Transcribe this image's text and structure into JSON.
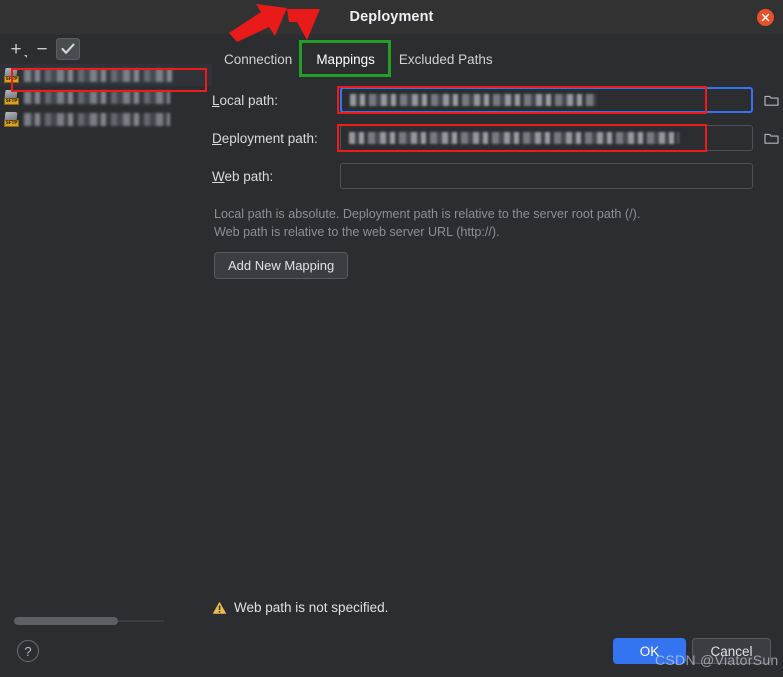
{
  "window": {
    "title": "Deployment",
    "close_icon": "close-icon"
  },
  "toolbar": {
    "add_label": "+",
    "remove_label": "−",
    "apply_icon": "checkmark-icon"
  },
  "sidebar": {
    "servers": [
      {
        "icon": "sftp-server-icon",
        "name": "",
        "redacted": true,
        "selected": true
      },
      {
        "icon": "sftp-server-icon",
        "name": "",
        "redacted": true,
        "selected": false
      },
      {
        "icon": "sftp-server-icon",
        "name": "",
        "redacted": true,
        "selected": false
      }
    ],
    "scrollbar": "horizontal-scrollbar",
    "help_label": "?"
  },
  "tabs": [
    {
      "label": "Connection",
      "active": false
    },
    {
      "label": "Mappings",
      "active": true
    },
    {
      "label": "Excluded Paths",
      "active": false
    }
  ],
  "fields": {
    "local": {
      "label": "Local path:",
      "value": "",
      "redacted": true,
      "focused": true,
      "browse_icon": "folder-icon"
    },
    "deployment": {
      "label": "Deployment path:",
      "value": "",
      "redacted": true,
      "focused": false,
      "browse_icon": "folder-icon"
    },
    "web": {
      "label": "Web path:",
      "value": "",
      "placeholder": "",
      "redacted": false,
      "focused": false
    }
  },
  "hint": {
    "line1": "Local path is absolute. Deployment path is relative to the server root path (/).",
    "line2": "Web path is relative to the web server URL (http://)."
  },
  "actions": {
    "add_new_mapping": "Add New Mapping",
    "ok": "OK",
    "cancel": "Cancel"
  },
  "status": {
    "warning_icon": "warning-triangle-icon",
    "warning_text": "Web path is not specified."
  },
  "watermark": {
    "text": "CSDN @ViatorSun"
  },
  "annotations": {
    "red_box_sidebar": "red-highlight-box",
    "red_box_local_path": "red-highlight-box",
    "red_box_deployment_path": "red-highlight-box",
    "green_box_mappings_tab": "green-highlight-box",
    "arrows": "red-arrows-pointing-to-mappings-tab"
  },
  "colors": {
    "background": "#2b2d30",
    "titlebar": "#323232",
    "accent_blue": "#3574f0",
    "close_red": "#e8502b",
    "annotation_red": "#ef1b1b",
    "annotation_green": "#23a023",
    "warning_yellow": "#e8bd4a",
    "sftp_icon_yellow": "#d8a323"
  }
}
